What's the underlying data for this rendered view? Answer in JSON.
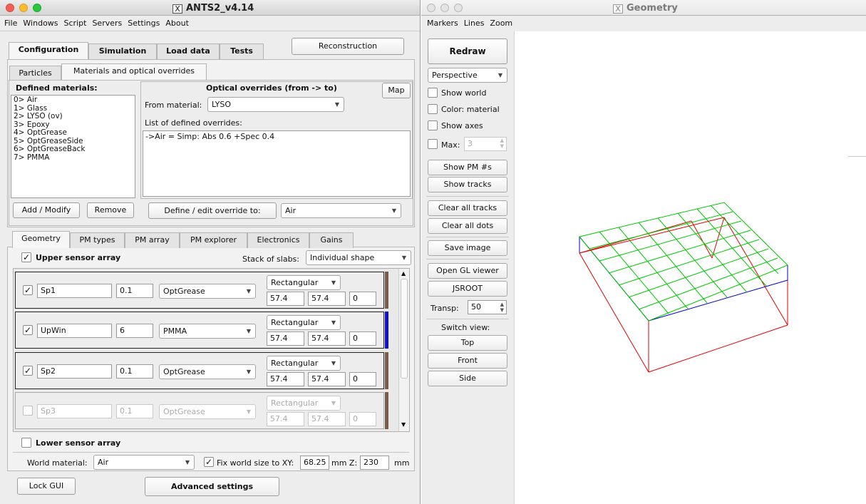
{
  "main": {
    "title": "ANTS2_v4.14",
    "menu": [
      "File",
      "Windows",
      "Script",
      "Servers",
      "Settings",
      "About"
    ],
    "top_tabs": [
      "Configuration",
      "Simulation",
      "Load data",
      "Tests"
    ],
    "reconstruction_label": "Reconstruction",
    "sub_tabs": [
      "Particles",
      "Materials and optical overrides"
    ],
    "defined_materials_label": "Defined materials:",
    "materials": [
      "0> Air",
      "1> Glass",
      "2> LYSO  (ov)",
      "3> Epoxy",
      "4> OptGrease",
      "5> OptGreaseSide",
      "6> OptGreaseBack",
      "7> PMMA"
    ],
    "add_modify_label": "Add / Modify",
    "remove_label": "Remove",
    "overrides_title": "Optical overrides (from -> to)",
    "map_label": "Map",
    "from_material_label": "From material:",
    "from_material_value": "LYSO",
    "overrides_list_label": "List of defined overrides:",
    "overrides": [
      "->Air = Simp: Abs 0.6 +Spec 0.4"
    ],
    "define_override_label": "Define / edit override to:",
    "override_target": "Air",
    "detector_tabs": [
      "Geometry",
      "PM types",
      "PM array",
      "PM explorer",
      "Electronics",
      "Gains"
    ],
    "upper_sensor_label": "Upper sensor array",
    "stack_label": "Stack of slabs:",
    "stack_value": "Individual shape",
    "slabs": [
      {
        "name": "Sp1",
        "thickness": "0.1",
        "material": "OptGrease",
        "shape": "Rectangular",
        "x": "57.4",
        "y": "57.4",
        "angle": "0",
        "color": "#7a5a48",
        "enabled": true
      },
      {
        "name": "UpWin",
        "thickness": "6",
        "material": "PMMA",
        "shape": "Rectangular",
        "x": "57.4",
        "y": "57.4",
        "angle": "0",
        "color": "#1010d0",
        "enabled": true
      },
      {
        "name": "Sp2",
        "thickness": "0.1",
        "material": "OptGrease",
        "shape": "Rectangular",
        "x": "57.4",
        "y": "57.4",
        "angle": "0",
        "color": "#7a5a48",
        "enabled": true
      },
      {
        "name": "Sp3",
        "thickness": "0.1",
        "material": "OptGrease",
        "shape": "Rectangular",
        "x": "57.4",
        "y": "57.4",
        "angle": "0",
        "color": "#7a5a48",
        "enabled": false
      }
    ],
    "lower_sensor_label": "Lower sensor array",
    "world_material_label": "World material:",
    "world_material_value": "Air",
    "fix_world_label": "Fix world size to XY:",
    "world_xy": "68.25",
    "mm_z_label": "mm Z:",
    "world_z": "230",
    "mm_label": "mm",
    "lock_gui_label": "Lock GUI",
    "advanced_label": "Advanced settings"
  },
  "geometry": {
    "title": "Geometry",
    "menu": [
      "Markers",
      "Lines",
      "Zoom"
    ],
    "redraw_label": "Redraw",
    "view_mode": "Perspective",
    "show_world_label": "Show world",
    "color_material_label": "Color: material",
    "show_axes_label": "Show axes",
    "max_label": "Max:",
    "max_value": "3",
    "show_pm_label": "Show PM #s",
    "show_tracks_label": "Show tracks",
    "clear_tracks_label": "Clear all tracks",
    "clear_dots_label": "Clear all dots",
    "save_image_label": "Save image",
    "open_gl_label": "Open GL viewer",
    "jsroot_label": "JSROOT",
    "transp_label": "Transp:",
    "transp_value": "50",
    "switch_view_label": "Switch view:",
    "top_label": "Top",
    "front_label": "Front",
    "side_label": "Side",
    "colors": {
      "world": "#e00000",
      "pm": "#00c800",
      "slab": "#0000d0"
    }
  }
}
